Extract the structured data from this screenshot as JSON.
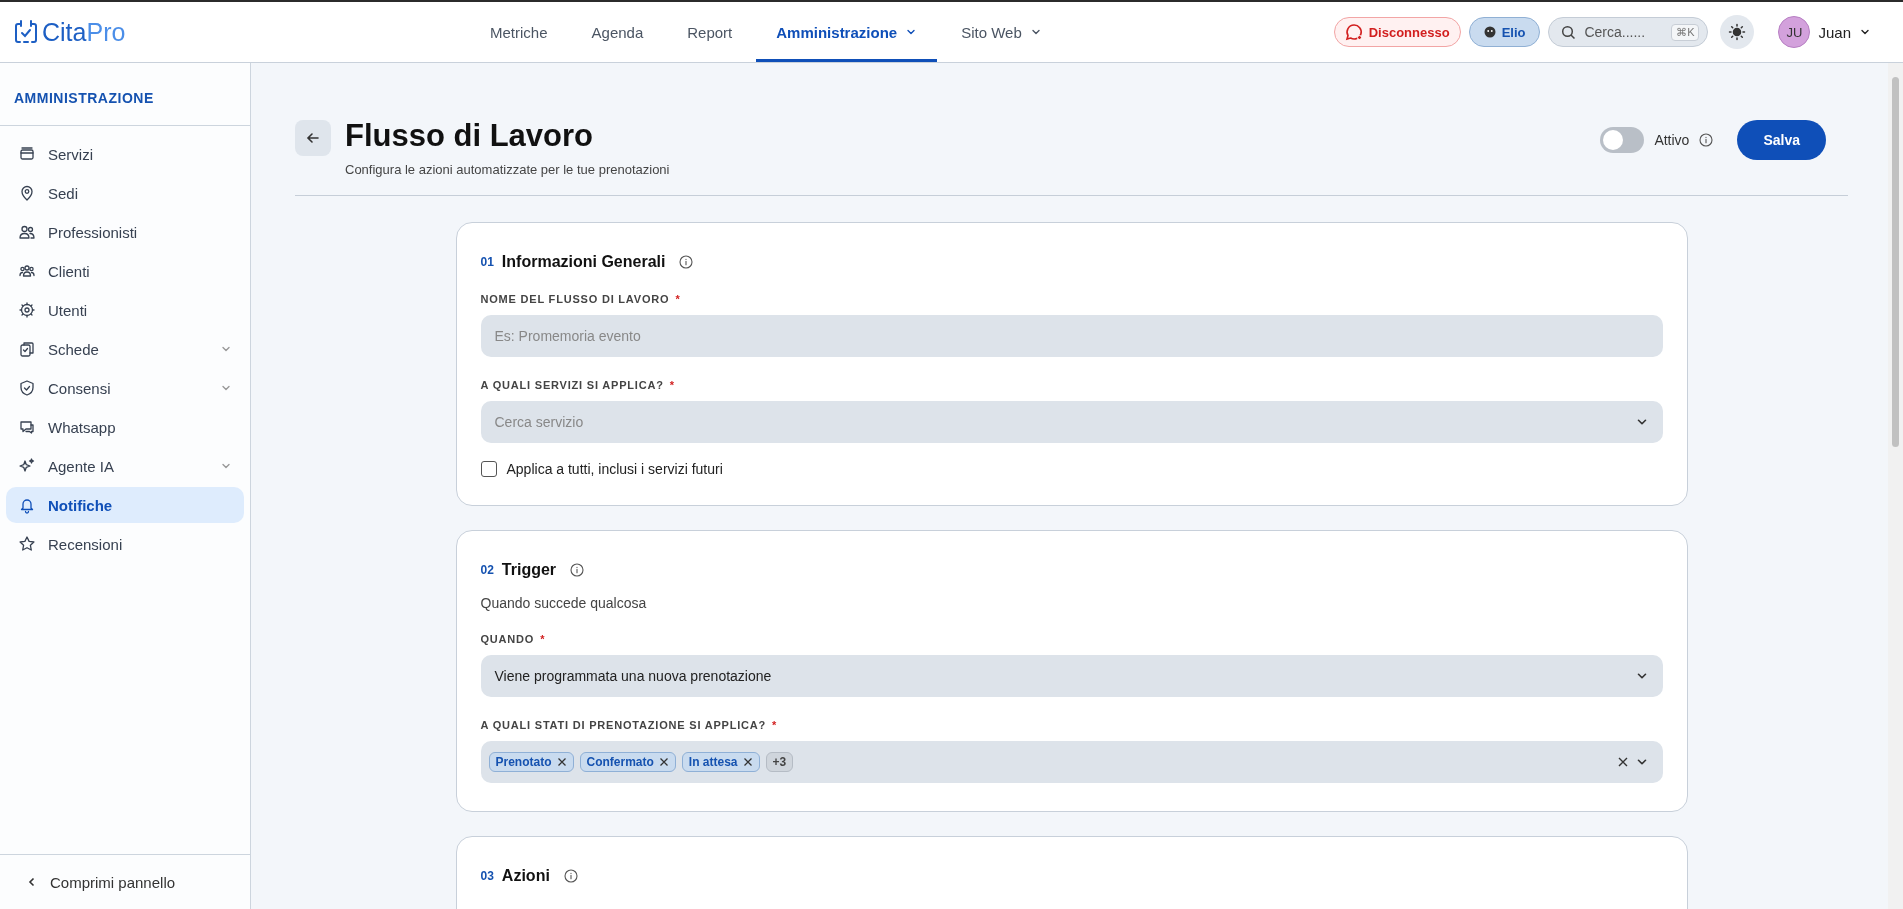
{
  "logo": {
    "part_1": "Cita",
    "part_2": "Pro"
  },
  "nav": [
    {
      "label": "Metriche",
      "selected": false,
      "has_menu": false
    },
    {
      "label": "Agenda",
      "selected": false,
      "has_menu": false
    },
    {
      "label": "Report",
      "selected": false,
      "has_menu": false
    },
    {
      "label": "Amministrazione",
      "selected": true,
      "has_menu": true
    },
    {
      "label": "Sito Web",
      "selected": false,
      "has_menu": true
    }
  ],
  "whatsapp_status": {
    "label": "Disconnesso"
  },
  "agent": {
    "label": "Elio"
  },
  "search": {
    "placeholder": "Cerca......",
    "shortcut": "⌘K"
  },
  "user": {
    "initials": "JU",
    "name": "Juan"
  },
  "sidebar": {
    "title": "AMMINISTRAZIONE",
    "items": [
      {
        "label": "Servizi",
        "selected": false,
        "expandable": false
      },
      {
        "label": "Sedi",
        "selected": false,
        "expandable": false
      },
      {
        "label": "Professionisti",
        "selected": false,
        "expandable": false
      },
      {
        "label": "Clienti",
        "selected": false,
        "expandable": false
      },
      {
        "label": "Utenti",
        "selected": false,
        "expandable": false
      },
      {
        "label": "Schede",
        "selected": false,
        "expandable": true
      },
      {
        "label": "Consensi",
        "selected": false,
        "expandable": true
      },
      {
        "label": "Whatsapp",
        "selected": false,
        "expandable": false
      },
      {
        "label": "Agente IA",
        "selected": false,
        "expandable": true
      },
      {
        "label": "Notifiche",
        "selected": true,
        "expandable": false
      },
      {
        "label": "Recensioni",
        "selected": false,
        "expandable": false
      }
    ],
    "collapse": "Comprimi pannello"
  },
  "page": {
    "title": "Flusso di Lavoro",
    "subtitle": "Configura le azioni automatizzate per le tue prenotazioni",
    "active_toggle": {
      "label": "Attivo",
      "on": false
    },
    "save": "Salva"
  },
  "sections": [
    {
      "number": "01",
      "title": "Informazioni Generali",
      "fields": [
        {
          "kind": "text",
          "label": "NOME DEL FLUSSO DI LAVORO",
          "required_mark": "*",
          "placeholder": "Es: Promemoria evento"
        },
        {
          "kind": "select",
          "label": "A QUALI SERVIZI SI APPLICA?",
          "required_mark": "*",
          "placeholder": "Cerca servizio"
        },
        {
          "kind": "checkbox",
          "label": "Applica a tutti, inclusi i servizi futuri",
          "checked": false
        }
      ]
    },
    {
      "number": "02",
      "title": "Trigger",
      "description": "Quando succede qualcosa",
      "fields": [
        {
          "kind": "select",
          "label": "QUANDO",
          "required_mark": "*",
          "value": "Viene programmata una nuova prenotazione"
        },
        {
          "kind": "multiselect",
          "label": "A QUALI STATI DI PRENOTAZIONE SI APPLICA?",
          "required_mark": "*",
          "tags": [
            "Prenotato",
            "Confermato",
            "In attesa"
          ],
          "more": "+3"
        }
      ]
    },
    {
      "number": "03",
      "title": "Azioni",
      "fields": [
        {
          "kind": "cutoff"
        }
      ]
    }
  ]
}
